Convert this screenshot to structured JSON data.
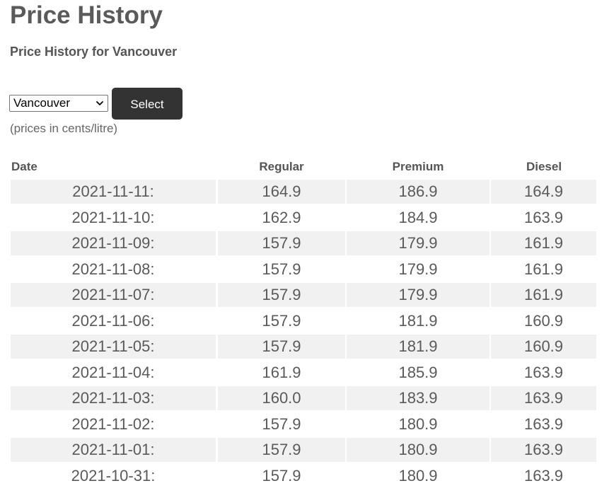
{
  "page": {
    "title": "Price History",
    "subtitle": "Price History for Vancouver"
  },
  "controls": {
    "city_selected": "Vancouver",
    "select_button_label": "Select",
    "unit_note": "(prices in cents/litre)"
  },
  "table": {
    "headers": {
      "date": "Date",
      "regular": "Regular",
      "premium": "Premium",
      "diesel": "Diesel"
    },
    "rows": [
      {
        "date": "2021-11-11:",
        "regular": "164.9",
        "premium": "186.9",
        "diesel": "164.9"
      },
      {
        "date": "2021-11-10:",
        "regular": "162.9",
        "premium": "184.9",
        "diesel": "163.9"
      },
      {
        "date": "2021-11-09:",
        "regular": "157.9",
        "premium": "179.9",
        "diesel": "161.9"
      },
      {
        "date": "2021-11-08:",
        "regular": "157.9",
        "premium": "179.9",
        "diesel": "161.9"
      },
      {
        "date": "2021-11-07:",
        "regular": "157.9",
        "premium": "179.9",
        "diesel": "161.9"
      },
      {
        "date": "2021-11-06:",
        "regular": "157.9",
        "premium": "181.9",
        "diesel": "160.9"
      },
      {
        "date": "2021-11-05:",
        "regular": "157.9",
        "premium": "181.9",
        "diesel": "160.9"
      },
      {
        "date": "2021-11-04:",
        "regular": "161.9",
        "premium": "185.9",
        "diesel": "163.9"
      },
      {
        "date": "2021-11-03:",
        "regular": "160.0",
        "premium": "183.9",
        "diesel": "163.9"
      },
      {
        "date": "2021-11-02:",
        "regular": "157.9",
        "premium": "180.9",
        "diesel": "163.9"
      },
      {
        "date": "2021-11-01:",
        "regular": "157.9",
        "premium": "180.9",
        "diesel": "163.9"
      },
      {
        "date": "2021-10-31:",
        "regular": "157.9",
        "premium": "180.9",
        "diesel": "163.9"
      }
    ]
  },
  "icons": {
    "dropdown": "chevron-down-icon"
  },
  "colors": {
    "button_bg": "#333333",
    "row_shade": "#f1f1f1",
    "text": "#555555"
  }
}
